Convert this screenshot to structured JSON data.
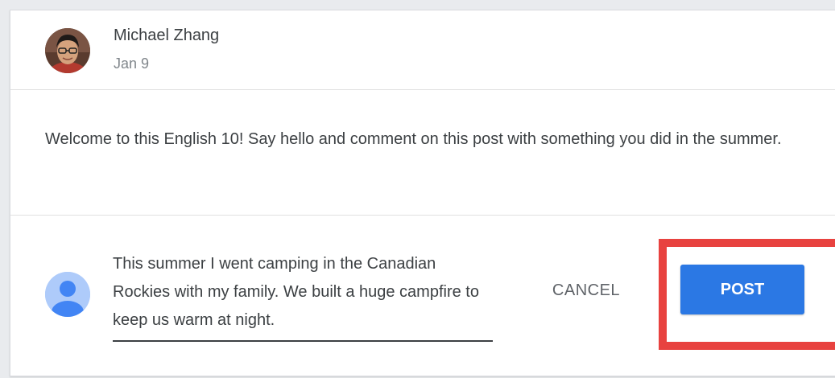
{
  "post": {
    "author": "Michael Zhang",
    "date": "Jan 9",
    "body": "Welcome to this English 10! Say hello and comment on this post with something you did in the summer."
  },
  "comment": {
    "value": "This summer I went camping in the Canadian Rockies with my family. We built a huge campfire to keep us warm at night.",
    "cancel_label": "CANCEL",
    "post_label": "POST"
  },
  "colors": {
    "accent": "#2b78e4",
    "highlight": "#e8423f",
    "user_avatar": "#aecbfa"
  },
  "icons": {
    "author_avatar": "author-avatar-photo",
    "user_avatar": "user-avatar-icon"
  }
}
